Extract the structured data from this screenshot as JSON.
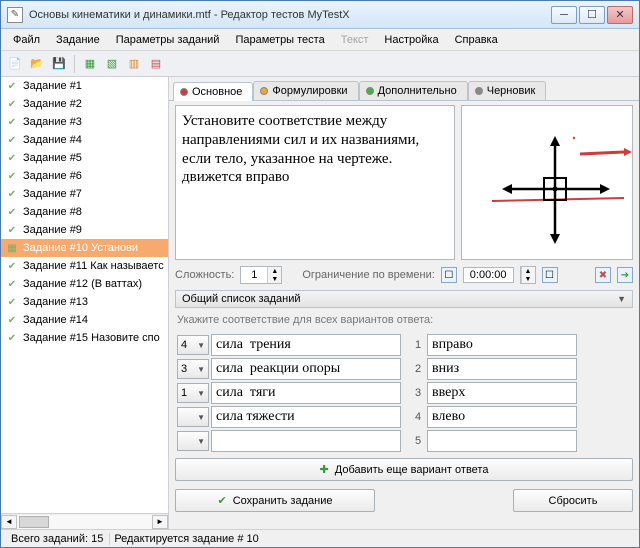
{
  "window": {
    "title": "Основы  кинематики и динамики.mtf - Редактор тестов MyTestX"
  },
  "menu": {
    "file": "Файл",
    "task": "Задание",
    "params_tasks": "Параметры заданий",
    "params_test": "Параметры теста",
    "text": "Текст",
    "settings": "Настройка",
    "help": "Справка"
  },
  "tabs": {
    "main": "Основное",
    "formul": "Формулировки",
    "extra": "Дополнительно",
    "draft": "Черновик"
  },
  "question_text": "Установите соответствие между направлениями сил   и их  названиями, если тело, указанное на чертеже. движется вправо",
  "props": {
    "complexity_label": "Сложность:",
    "complexity_value": "1",
    "timelimit_label": "Ограничение по времени:",
    "timelimit_value": "0:00:00"
  },
  "list_header": "Общий список заданий",
  "hint": "Укажите соответствие для всех вариантов ответа:",
  "tasks": [
    {
      "label": "Задание #1"
    },
    {
      "label": "Задание #2"
    },
    {
      "label": "Задание #3"
    },
    {
      "label": "Задание #4"
    },
    {
      "label": "Задание #5"
    },
    {
      "label": "Задание #6"
    },
    {
      "label": "Задание #7"
    },
    {
      "label": "Задание #8"
    },
    {
      "label": "Задание #9"
    },
    {
      "label": "Задание #10 Установи"
    },
    {
      "label": "Задание #11 Как  называетс"
    },
    {
      "label": "Задание #12 (В ваттах)"
    },
    {
      "label": "Задание #13"
    },
    {
      "label": "Задание #14"
    },
    {
      "label": "Задание #15 Назовите  спо"
    }
  ],
  "selected_task_index": 9,
  "answers_left": [
    {
      "sel": "4",
      "text": "сила  трения"
    },
    {
      "sel": "3",
      "text": "сила  реакции опоры"
    },
    {
      "sel": "1",
      "text": "сила  тяги"
    },
    {
      "sel": "",
      "text": "сила тяжести"
    },
    {
      "sel": "",
      "text": ""
    }
  ],
  "answers_right": [
    {
      "n": "1",
      "text": "вправо"
    },
    {
      "n": "2",
      "text": "вниз"
    },
    {
      "n": "3",
      "text": "вверх"
    },
    {
      "n": "4",
      "text": "влево"
    },
    {
      "n": "5",
      "text": ""
    }
  ],
  "buttons": {
    "add_variant": "Добавить еще вариант ответа",
    "save": "Сохранить задание",
    "reset": "Сбросить"
  },
  "status": {
    "total": "Всего заданий: 15",
    "editing": "Редактируется задание # 10"
  },
  "colors": {
    "tab_main": "#d43a3a",
    "tab_formul": "#e8a83a",
    "tab_extra": "#44b04a",
    "tab_draft": "#8a8a8a"
  }
}
